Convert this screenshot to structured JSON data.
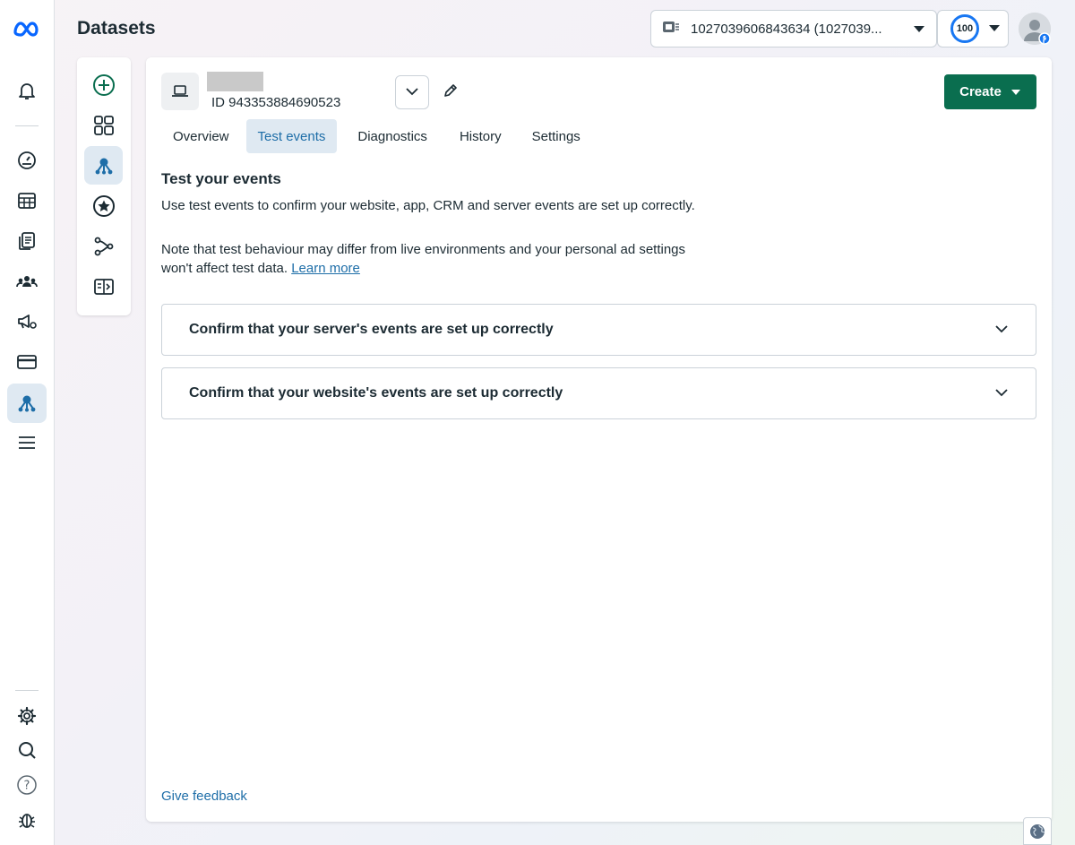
{
  "header": {
    "title": "Datasets",
    "account_select": {
      "value": "1027039606843634 (1027039...",
      "icon": "business-card-icon"
    },
    "score_select": {
      "value": "100"
    }
  },
  "left_rail": {
    "top": [
      "meta-logo-icon",
      "notifications-icon"
    ],
    "middle": [
      "dashboard-gauge-icon",
      "table-icon",
      "documents-icon",
      "audiences-icon",
      "ads-megaphone-icon",
      "billing-card-icon",
      "events-manager-icon",
      "menu-icon"
    ],
    "bottom": [
      "settings-icon",
      "search-icon",
      "help-icon",
      "bug-report-icon"
    ]
  },
  "subnav": [
    "add-icon",
    "overview-grid-icon",
    "datasets-icon",
    "custom-conversions-icon",
    "partner-integrations-icon",
    "tag-icon"
  ],
  "dataset": {
    "id_text": "ID 943353884690523",
    "create_label": "Create"
  },
  "tabs": [
    {
      "label": "Overview",
      "active": false
    },
    {
      "label": "Test events",
      "active": true
    },
    {
      "label": "Diagnostics",
      "active": false
    },
    {
      "label": "History",
      "active": false
    },
    {
      "label": "Settings",
      "active": false
    }
  ],
  "content": {
    "title": "Test your events",
    "description": "Use test events to confirm your website, app, CRM and server events are set up correctly.",
    "note": "Note that test behaviour may differ from live environments and your personal ad settings won't affect test data.",
    "learn_more": "Learn more",
    "accordions": [
      "Confirm that your server's events are set up correctly",
      "Confirm that your website's events are set up correctly"
    ],
    "feedback": "Give feedback"
  },
  "colors": {
    "create_button": "#0a6e4f",
    "link": "#1e6ea8",
    "active_tab_bg": "#dfe9f2",
    "meta_blue": "#0866ff"
  }
}
